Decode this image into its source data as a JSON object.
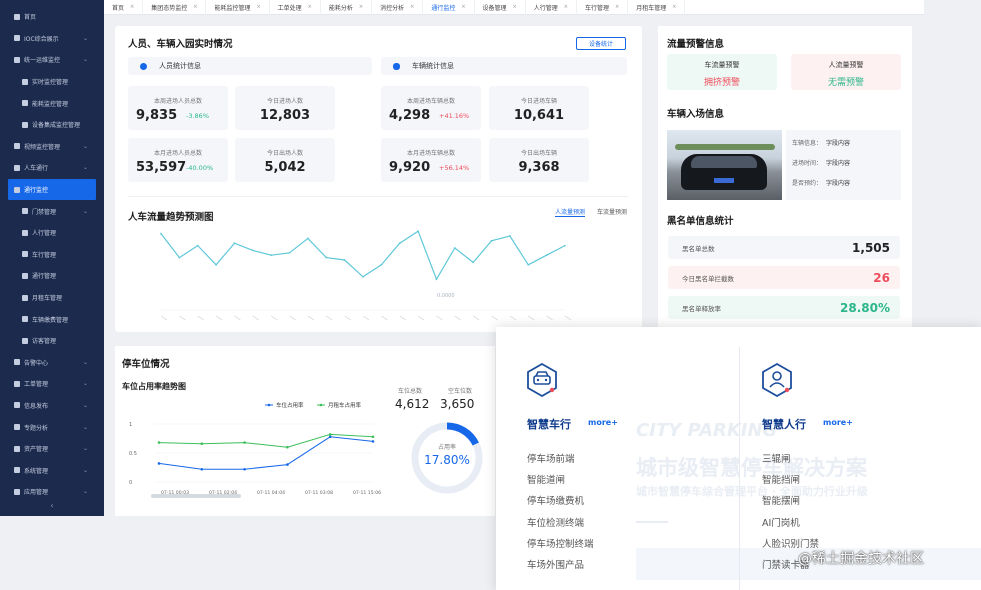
{
  "sidebar": {
    "items": [
      {
        "label": "首页",
        "sub": false,
        "chev": false,
        "active": false
      },
      {
        "label": "IOC综合展示",
        "sub": false,
        "chev": true,
        "active": false
      },
      {
        "label": "统一运维监控",
        "sub": false,
        "chev": true,
        "active": false
      },
      {
        "label": "实时监控管理",
        "sub": true,
        "chev": false,
        "active": false
      },
      {
        "label": "能耗监控管理",
        "sub": true,
        "chev": false,
        "active": false
      },
      {
        "label": "设备集成监控管理",
        "sub": true,
        "chev": false,
        "active": false
      },
      {
        "label": "视频监控管理",
        "sub": false,
        "chev": true,
        "active": false
      },
      {
        "label": "人车通行",
        "sub": false,
        "chev": true,
        "active": false
      },
      {
        "label": "通行监控",
        "sub": true,
        "chev": false,
        "active": true
      },
      {
        "label": "门禁管理",
        "sub": true,
        "chev": true,
        "active": false
      },
      {
        "label": "人行管理",
        "sub": true,
        "chev": false,
        "active": false
      },
      {
        "label": "车行管理",
        "sub": true,
        "chev": false,
        "active": false
      },
      {
        "label": "通行管理",
        "sub": true,
        "chev": false,
        "active": false
      },
      {
        "label": "月租车管理",
        "sub": true,
        "chev": false,
        "active": false
      },
      {
        "label": "车辆缴费管理",
        "sub": true,
        "chev": false,
        "active": false
      },
      {
        "label": "访客管理",
        "sub": true,
        "chev": false,
        "active": false
      },
      {
        "label": "告警中心",
        "sub": false,
        "chev": true,
        "active": false
      },
      {
        "label": "工单管理",
        "sub": false,
        "chev": true,
        "active": false
      },
      {
        "label": "信息发布",
        "sub": false,
        "chev": true,
        "active": false
      },
      {
        "label": "专题分析",
        "sub": false,
        "chev": true,
        "active": false
      },
      {
        "label": "资产管理",
        "sub": false,
        "chev": true,
        "active": false
      },
      {
        "label": "系统管理",
        "sub": false,
        "chev": true,
        "active": false
      },
      {
        "label": "应用管理",
        "sub": false,
        "chev": true,
        "active": false
      }
    ],
    "collapse": "‹"
  },
  "tabs": [
    {
      "label": "首页",
      "active": false
    },
    {
      "label": "集团态势监控",
      "active": false
    },
    {
      "label": "能耗监控管理",
      "active": false
    },
    {
      "label": "工单处理",
      "active": false
    },
    {
      "label": "能耗分析",
      "active": false
    },
    {
      "label": "消控分析",
      "active": false
    },
    {
      "label": "通行监控",
      "active": true
    },
    {
      "label": "设备管理",
      "active": false
    },
    {
      "label": "人行管理",
      "active": false
    },
    {
      "label": "车行管理",
      "active": false
    },
    {
      "label": "月租车管理",
      "active": false
    }
  ],
  "main": {
    "title": "人员、车辆入园实时情况",
    "device_btn": "设备统计",
    "person_head": "人员统计信息",
    "vehicle_head": "车辆统计信息",
    "stats": [
      {
        "label": "本周进场人员总数",
        "value": "9,835",
        "pct": "-3.86%",
        "pct_color": "green"
      },
      {
        "label": "今日进场人数",
        "value": "12,803",
        "pct": "",
        "pct_color": ""
      },
      {
        "label": "本周进场车辆总数",
        "value": "4,298",
        "pct": "+41.16%",
        "pct_color": "red"
      },
      {
        "label": "今日进场车辆",
        "value": "10,641",
        "pct": "",
        "pct_color": ""
      },
      {
        "label": "本月进场人员总数",
        "value": "53,597",
        "pct": "-40.00%",
        "pct_color": "green"
      },
      {
        "label": "今日出场人数",
        "value": "5,042",
        "pct": "",
        "pct_color": ""
      },
      {
        "label": "本月进场车辆总数",
        "value": "9,920",
        "pct": "+56.14%",
        "pct_color": "red"
      },
      {
        "label": "今日出场车辆",
        "value": "9,368",
        "pct": "",
        "pct_color": ""
      }
    ],
    "trend_title": "人车流量趋势预测图",
    "trend_legend": [
      "人流量预测",
      "车流量预测"
    ],
    "trend_annotation": "0.0000"
  },
  "right": {
    "alert_title": "流量预警信息",
    "vehicle_alert": {
      "title": "车流量预警",
      "value": "拥挤预警"
    },
    "person_alert": {
      "title": "人流量预警",
      "value": "无需预警"
    },
    "entry_title": "车辆入场信息",
    "entry_rows": [
      {
        "label": "车辆信息：",
        "value": "字段内容"
      },
      {
        "label": "进场时间：",
        "value": "字段内容"
      },
      {
        "label": "是否预约：",
        "value": "字段内容"
      }
    ],
    "blacklist_title": "黑名单信息统计",
    "blacklist": [
      {
        "label": "黑名单总数",
        "value": "1,505",
        "color": "#222222",
        "bg": "#f4f6fa"
      },
      {
        "label": "今日黑名单拦截数",
        "value": "26",
        "color": "#ee4d5c",
        "bg": "#fdf1f2"
      },
      {
        "label": "黑名单释放率",
        "value": "28.80%",
        "color": "#2cb68a",
        "bg": "#eef8f4"
      }
    ]
  },
  "parking": {
    "title": "停车位情况",
    "chart_title": "车位占用率趋势图",
    "stat1_label": "车位总数",
    "stat1_value": "4,612",
    "stat2_label": "空车位数",
    "stat2_value": "3,650",
    "gauge_label": "占用率",
    "gauge_value": "17.80%"
  },
  "chart_data": [
    {
      "type": "line",
      "title": "人车流量趋势预测图",
      "legend": [
        "人流量预测",
        "车流量预测"
      ],
      "series": [
        {
          "name": "人流量预测",
          "values": [
            62,
            42,
            52,
            36,
            54,
            48,
            44,
            46,
            58,
            42,
            40,
            26,
            36,
            54,
            64,
            24,
            50,
            38,
            56,
            60,
            36,
            44,
            52
          ]
        }
      ],
      "grid": false
    },
    {
      "type": "line",
      "title": "车位占用率趋势图",
      "categories": [
        "07-11 00:03",
        "07-11 02:04",
        "07-11 04:04",
        "07-11 03:08",
        "07-11 15:06"
      ],
      "yticks": [
        "0",
        "0.5",
        "1"
      ],
      "ylim": [
        0,
        1
      ],
      "series": [
        {
          "name": "车位占用率",
          "color": "#1768e8",
          "values": [
            0.32,
            0.22,
            0.22,
            0.3,
            0.78,
            0.7
          ]
        },
        {
          "name": "月租车占用率",
          "color": "#3cbf5b",
          "values": [
            0.68,
            0.66,
            0.68,
            0.6,
            0.82,
            0.78
          ]
        }
      ]
    }
  ],
  "overlay": {
    "ghost_line1": "CITY PARKING",
    "ghost_line2": "城市级智慧停车解决方案",
    "ghost_line3": "城市智慧停车综合管理平台 · 全面助力行业升级",
    "col1": {
      "title": "智慧车行",
      "more": "more+",
      "items": [
        "停车场前端",
        "智能道闸",
        "停车场缴费机",
        "车位检测终端",
        "停车场控制终端",
        "车场外围产品"
      ]
    },
    "col2": {
      "title": "智慧人行",
      "more": "more+",
      "items": [
        "三辊闸",
        "智能挡闸",
        "智能摆闸",
        "AI门岗机",
        "人脸识别门禁",
        "门禁读卡器"
      ]
    }
  },
  "watermark": "@稀土掘金技术社区"
}
